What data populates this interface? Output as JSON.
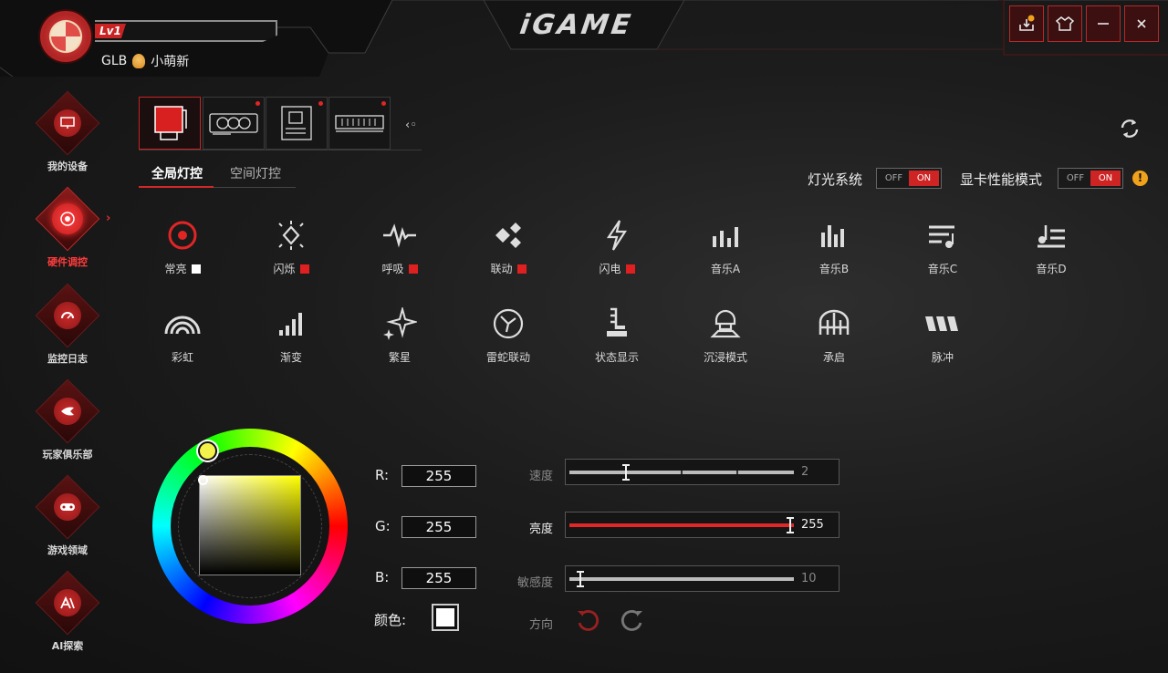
{
  "user": {
    "level": "Lv1",
    "name_prefix": "GLB",
    "name": "小萌新"
  },
  "app": {
    "logo": "iGAME"
  },
  "window_controls": [
    "download-icon",
    "skin-icon",
    "minimize-icon",
    "close-icon"
  ],
  "sidebar": {
    "items": [
      {
        "label": "我的设备",
        "icon": "monitor-icon"
      },
      {
        "label": "硬件调控",
        "icon": "control-icon",
        "active": true
      },
      {
        "label": "监控日志",
        "icon": "gauge-icon"
      },
      {
        "label": "玩家俱乐部",
        "icon": "club-icon"
      },
      {
        "label": "游戏领域",
        "icon": "gamepad-icon"
      },
      {
        "label": "AI探索",
        "icon": "ai-icon"
      }
    ]
  },
  "devices": [
    {
      "name": "aio-cooler-icon",
      "active": true,
      "dot": false
    },
    {
      "name": "graphics-card-icon",
      "active": false,
      "dot": true
    },
    {
      "name": "motherboard-icon",
      "active": false,
      "dot": true
    },
    {
      "name": "memory-icon",
      "active": false,
      "dot": true
    }
  ],
  "tabs": {
    "global": "全局灯控",
    "spatial": "空间灯控"
  },
  "toggles": {
    "lighting": {
      "label": "灯光系统",
      "off": "OFF",
      "on": "ON"
    },
    "gpu_mode": {
      "label": "显卡性能模式",
      "off": "OFF",
      "on": "ON"
    }
  },
  "effects": [
    {
      "label": "常亮",
      "icon": "target-icon",
      "swatch": "#ffffff"
    },
    {
      "label": "闪烁",
      "icon": "flash-burst-icon",
      "swatch": "#e02020"
    },
    {
      "label": "呼吸",
      "icon": "pulse-wave-icon",
      "swatch": "#e02020"
    },
    {
      "label": "联动",
      "icon": "link-diamond-icon",
      "swatch": "#e02020"
    },
    {
      "label": "闪电",
      "icon": "lightning-icon",
      "swatch": "#e02020"
    },
    {
      "label": "音乐A",
      "icon": "bars-a-icon"
    },
    {
      "label": "音乐B",
      "icon": "bars-b-icon"
    },
    {
      "label": "音乐C",
      "icon": "music-list-icon"
    },
    {
      "label": "音乐D",
      "icon": "music-note-icon"
    },
    {
      "label": "彩虹",
      "icon": "rainbow-icon"
    },
    {
      "label": "渐变",
      "icon": "gradient-bars-icon"
    },
    {
      "label": "繁星",
      "icon": "stars-icon"
    },
    {
      "label": "雷蛇联动",
      "icon": "razer-icon"
    },
    {
      "label": "状态显示",
      "icon": "status-icon"
    },
    {
      "label": "沉浸模式",
      "icon": "immersive-icon"
    },
    {
      "label": "承启",
      "icon": "bridge-icon"
    },
    {
      "label": "脉冲",
      "icon": "pulse-icon"
    }
  ],
  "color": {
    "r_label": "R:",
    "g_label": "G:",
    "b_label": "B:",
    "r": "255",
    "g": "255",
    "b": "255",
    "color_label": "颜色:",
    "swatch": "#ffffff"
  },
  "sliders": {
    "speed": {
      "label": "速度",
      "value": "2",
      "fraction": 0.25
    },
    "brightness": {
      "label": "亮度",
      "value": "255",
      "fraction": 1.0
    },
    "sensitivity": {
      "label": "敏感度",
      "value": "10",
      "fraction": 0.05
    }
  },
  "direction": {
    "label": "方向"
  }
}
